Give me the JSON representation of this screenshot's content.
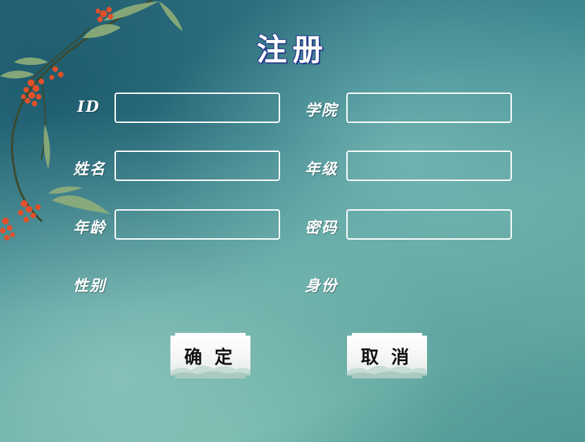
{
  "page": {
    "title": "注册"
  },
  "form": {
    "left": {
      "id_label": "ID",
      "name_label": "姓名",
      "age_label": "年龄",
      "gender_label": "性别"
    },
    "right": {
      "college_label": "学院",
      "grade_label": "年级",
      "password_label": "密码",
      "identity_label": "身份"
    },
    "values": {
      "id": "",
      "name": "",
      "age": "",
      "college": "",
      "grade": "",
      "password": ""
    }
  },
  "buttons": {
    "confirm": "确定",
    "cancel": "取消"
  },
  "decoration": {
    "branch_icon": "bamboo-branch-with-red-berries",
    "theme_color": "#4f9994",
    "border_color": "#ffffff"
  }
}
